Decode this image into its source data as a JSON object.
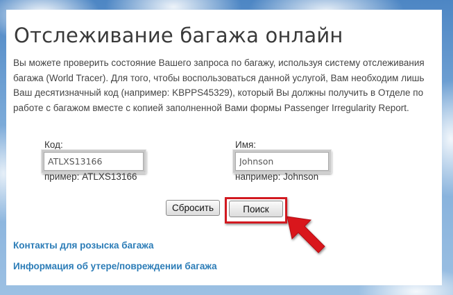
{
  "page": {
    "title": "Отслеживание багажа онлайн",
    "description": "Вы можете проверить состояние Вашего запроса по багажу, используя систему отслеживания багажа (World Tracer). Для того, чтобы воспользоваться данной услугой, Вам необходим лишь Ваш десятизначный код (например: KBPPS45329), который Вы должны получить в Отделе по работе с багажом вместе с копией заполненной Вами формы Passenger Irregularity Report."
  },
  "form": {
    "code": {
      "label": "Код:",
      "value": "ATLXS13166",
      "hint": "пример: ATLXS13166"
    },
    "name": {
      "label": "Имя:",
      "value": "Johnson",
      "hint": "например: Johnson"
    },
    "reset_label": "Сбросить",
    "search_label": "Поиск"
  },
  "links": {
    "contacts": "Контакты для розыска багажа",
    "damage_info": "Информация об утере/повреждении багажа"
  },
  "colors": {
    "highlight": "#d21920",
    "link": "#2b7cb7"
  },
  "icons": {
    "annotation": "red-arrow-icon"
  }
}
